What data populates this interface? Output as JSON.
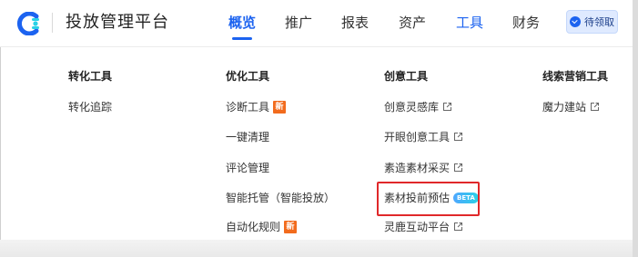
{
  "header": {
    "app_title": "投放管理平台",
    "logo_icon": "brand-c-logo-icon",
    "nav": [
      {
        "label": "概览",
        "state": "active"
      },
      {
        "label": "推广",
        "state": "normal"
      },
      {
        "label": "报表",
        "state": "normal"
      },
      {
        "label": "资产",
        "state": "normal"
      },
      {
        "label": "工具",
        "state": "highlighted"
      },
      {
        "label": "财务",
        "state": "normal"
      }
    ],
    "pending_button": {
      "label": "待领取",
      "icon": "check-circle-icon"
    }
  },
  "menu": {
    "columns": [
      {
        "title": "转化工具",
        "items": [
          {
            "label": "转化追踪"
          }
        ]
      },
      {
        "title": "优化工具",
        "items": [
          {
            "label": "诊断工具",
            "badge": "新"
          },
          {
            "label": "一键清理"
          },
          {
            "label": "评论管理"
          },
          {
            "label": "智能托管（智能投放）"
          },
          {
            "label": "自动化规则",
            "badge": "新"
          }
        ]
      },
      {
        "title": "创意工具",
        "items": [
          {
            "label": "创意灵感库",
            "icon": "external-link-icon"
          },
          {
            "label": "开眼创意工具",
            "icon": "external-link-icon"
          },
          {
            "label": "素造素材采买",
            "icon": "external-link-icon"
          },
          {
            "label": "素材投前预估",
            "badge": "BETA",
            "highlighted": true
          },
          {
            "label": "灵鹿互动平台",
            "icon": "external-link-icon"
          }
        ]
      },
      {
        "title": "线索营销工具",
        "items": [
          {
            "label": "魔力建站",
            "icon": "external-link-icon"
          }
        ]
      }
    ]
  },
  "colors": {
    "accent": "#1c63f0",
    "new_badge": "#f26b1d",
    "highlight_border": "#e0282a"
  }
}
